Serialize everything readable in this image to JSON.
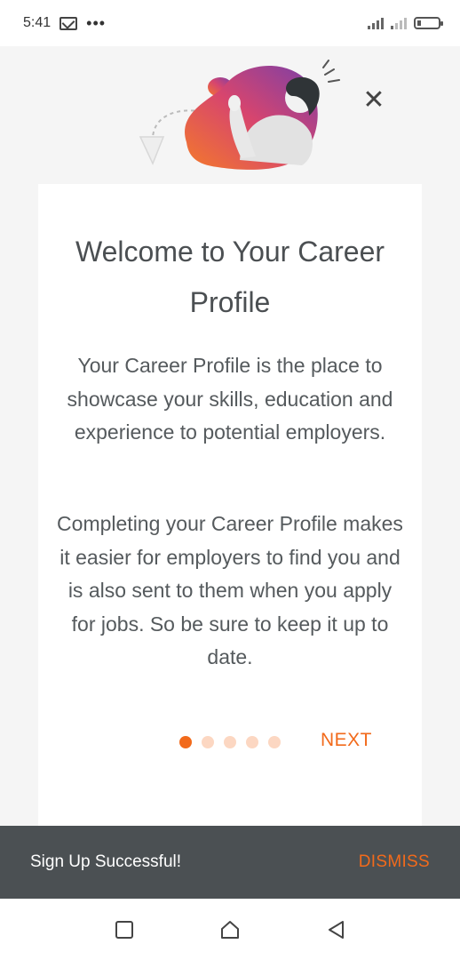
{
  "status_bar": {
    "time": "5:41",
    "overflow": "•••",
    "icons": [
      "mail-icon",
      "signal-icon",
      "signal-icon",
      "battery-icon"
    ]
  },
  "onboarding": {
    "title": "Welcome to Your Career Profile",
    "paragraph1": "Your Career Profile is the place to showcase your skills, education and experience to potential employers.",
    "paragraph2": "Completing your Career Profile makes it easier for employers to find you and is also sent to them when you apply for jobs. So be sure to keep it up to date.",
    "pager": {
      "total": 5,
      "current": 1
    },
    "next_label": "NEXT",
    "close_glyph": "✕"
  },
  "snackbar": {
    "message": "Sign Up Successful!",
    "action_label": "DISMISS"
  },
  "colors": {
    "accent": "#f26a1b",
    "accent_light": "#fcd7c2",
    "snackbar_bg": "#4b5053",
    "text": "#4b4f52"
  }
}
